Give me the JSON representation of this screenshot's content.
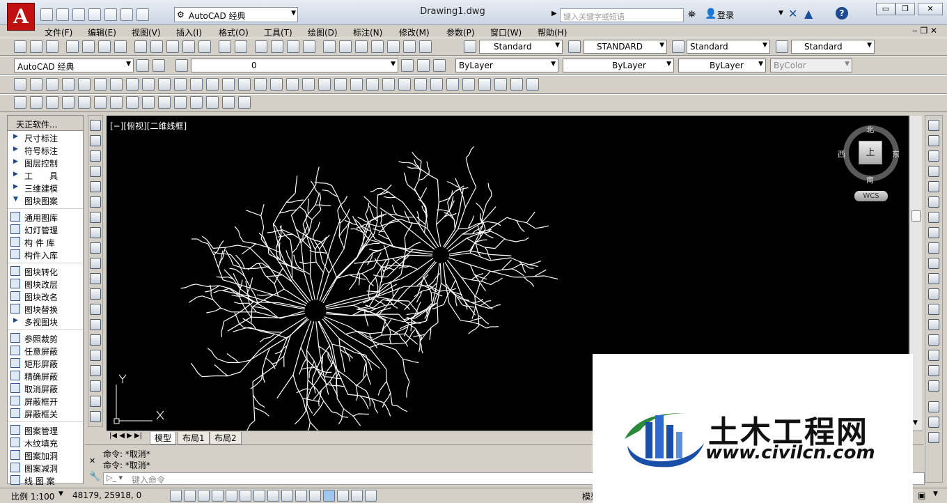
{
  "app": {
    "logo_letter": "A",
    "workspace": "AutoCAD 经典",
    "doc_title": "Drawing1.dwg",
    "search_placeholder": "键入关键字或短语",
    "login": "登录"
  },
  "menu": [
    "文件(F)",
    "编辑(E)",
    "视图(V)",
    "插入(I)",
    "格式(O)",
    "工具(T)",
    "绘图(D)",
    "标注(N)",
    "修改(M)",
    "参数(P)",
    "窗口(W)",
    "帮助(H)"
  ],
  "styles_toolbar": {
    "text_style": "Standard",
    "dim_style": "STANDARD",
    "table_style": "Standard",
    "mleader_style": "Standard"
  },
  "layers_toolbar": {
    "workspace": "AutoCAD 经典",
    "layer": "0",
    "color": "ByLayer",
    "linetype": "ByLayer",
    "lineweight": "ByLayer",
    "plotstyle": "ByColor"
  },
  "left_panel": {
    "title": "天正软件...",
    "items": [
      {
        "label": "尺寸标注",
        "icon": "tri"
      },
      {
        "label": "符号标注",
        "icon": "tri"
      },
      {
        "label": "图层控制",
        "icon": "tri"
      },
      {
        "label": "工　　具",
        "icon": "tri"
      },
      {
        "label": "三维建模",
        "icon": "tri"
      },
      {
        "label": "图块图案",
        "icon": "tri-down"
      },
      {
        "label": "通用图库",
        "icon": "box"
      },
      {
        "label": "幻灯管理",
        "icon": "box"
      },
      {
        "label": "构 件 库",
        "icon": "box"
      },
      {
        "label": "构件入库",
        "icon": "box"
      },
      {
        "label": "图块转化",
        "icon": "box"
      },
      {
        "label": "图块改层",
        "icon": "box"
      },
      {
        "label": "图块改名",
        "icon": "box"
      },
      {
        "label": "图块替换",
        "icon": "box"
      },
      {
        "label": "多视图块",
        "icon": "tri"
      },
      {
        "label": "参照裁剪",
        "icon": "box"
      },
      {
        "label": "任意屏蔽",
        "icon": "box"
      },
      {
        "label": "矩形屏蔽",
        "icon": "box"
      },
      {
        "label": "精确屏蔽",
        "icon": "box"
      },
      {
        "label": "取消屏蔽",
        "icon": "box"
      },
      {
        "label": "屏蔽框开",
        "icon": "box"
      },
      {
        "label": "屏蔽框关",
        "icon": "box"
      },
      {
        "label": "图案管理",
        "icon": "box"
      },
      {
        "label": "木纹填充",
        "icon": "box"
      },
      {
        "label": "图案加洞",
        "icon": "box"
      },
      {
        "label": "图案减洞",
        "icon": "box"
      },
      {
        "label": "线 图 案",
        "icon": "box"
      }
    ]
  },
  "canvas": {
    "viewport_label": "[−][俯视][二维线框]",
    "ucs_x": "X",
    "ucs_y": "Y"
  },
  "viewcube": {
    "north": "北",
    "south": "南",
    "east": "东",
    "west": "西",
    "top_face": "上",
    "wcs": "WCS"
  },
  "layout_tabs": [
    "模型",
    "布局1",
    "布局2"
  ],
  "command": {
    "history": [
      "命令: *取消*",
      "命令: *取消*"
    ],
    "placeholder": "键入命令"
  },
  "status": {
    "scale": "比例 1:100",
    "coords": "48179, 25918, 0",
    "model": "模型"
  },
  "watermark": {
    "title": "土木工程网",
    "url": "www.civilcn.com"
  }
}
